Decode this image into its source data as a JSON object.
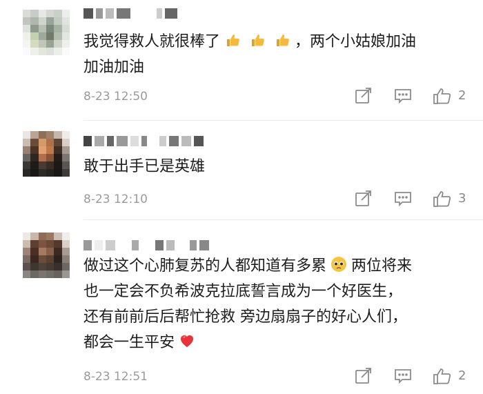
{
  "comments": [
    {
      "text_lines": [
        "我觉得救人就很棒了",
        "，两个小姑娘加油",
        "加油加油"
      ],
      "timestamp": "8-23 12:50",
      "likes": "2",
      "emojis": [
        "thumbs-up-icon",
        "thumbs-up-icon",
        "thumbs-up-icon"
      ]
    },
    {
      "text_lines": [
        "敢于出手已是英雄"
      ],
      "timestamp": "8-23 12:10",
      "likes": "3"
    },
    {
      "text_lines": [
        "做过这个心肺复苏的人都知道有多累",
        "两位将来",
        "也一定会不负希波克拉底誓言成为一个好医生，",
        "还有前前后后帮忙抢救 旁边扇扇子的好心人们，",
        "都会一生平安"
      ],
      "timestamp": "8-23 12:51",
      "likes": "2",
      "emojis": [
        "pleading-face-icon",
        "red-heart-icon"
      ]
    }
  ],
  "colors": {
    "text": "#1d1d1d",
    "meta": "#9a9a9a",
    "icon": "#8a8a8a",
    "heart": "#e8333a",
    "emoji_yellow": "#f5b93c"
  }
}
